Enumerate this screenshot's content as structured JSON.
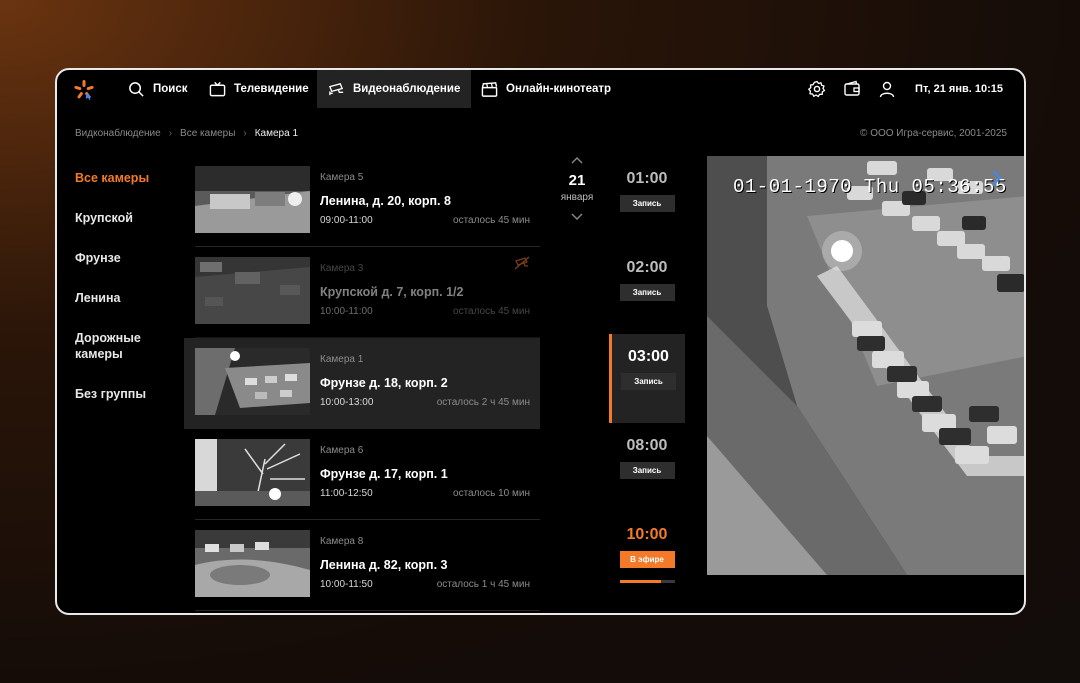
{
  "nav": {
    "items": [
      {
        "label": "Поиск",
        "icon": "search-icon"
      },
      {
        "label": "Телевидение",
        "icon": "tv-icon"
      },
      {
        "label": "Видеонаблюдение",
        "icon": "cctv-icon",
        "active": true
      },
      {
        "label": "Онлайн-кинотеатр",
        "icon": "clapperboard-icon"
      }
    ],
    "right_icons": [
      "settings-icon",
      "wallet-icon",
      "user-icon"
    ],
    "datetime": "Пт, 21 янв. 10:15"
  },
  "breadcrumbs": [
    "Видконаблюдение",
    "Все камеры",
    "Камера 1"
  ],
  "copyright": "© ООО Игра-сервис, 2001-2025",
  "groups": [
    {
      "label": "Все камеры",
      "active": true
    },
    {
      "label": "Крупской"
    },
    {
      "label": "Фрунзе"
    },
    {
      "label": "Ленина"
    },
    {
      "label": "Дорожные камеры"
    },
    {
      "label": "Без группы"
    }
  ],
  "cameras": [
    {
      "name": "Камера 5",
      "address": "Ленина, д. 20, корп. 8",
      "time": "09:00-11:00",
      "remaining": "осталось 45 мин"
    },
    {
      "name": "Камера 3",
      "address": "Крупской д. 7, корп. 1/2",
      "time": "10:00-11:00",
      "remaining": "осталось 45 мин",
      "offline": true
    },
    {
      "name": "Камера 1",
      "address": "Фрунзе д. 18, корп. 2",
      "time": "10:00-13:00",
      "remaining": "осталось  2 ч 45 мин",
      "active": true
    },
    {
      "name": "Камера 6",
      "address": "Фрунзе д. 17, корп. 1",
      "time": "11:00-12:50",
      "remaining": "осталось 10 мин"
    },
    {
      "name": "Камера 8",
      "address": "Ленина д. 82, корп. 3",
      "time": "10:00-11:50",
      "remaining": "осталось 1 ч 45 мин"
    }
  ],
  "date": {
    "day": "21",
    "month": "января"
  },
  "schedule": [
    {
      "time": "01:00",
      "button": "Запись"
    },
    {
      "time": "02:00",
      "button": "Запись"
    },
    {
      "time": "03:00",
      "button": "Запись",
      "active": true
    },
    {
      "time": "08:00",
      "button": "Запись"
    },
    {
      "time": "10:00",
      "button": "В эфире",
      "live": true,
      "progress": 0.75
    }
  ],
  "video": {
    "osd": "01-01-1970 Thu 05:36:55"
  },
  "colors": {
    "accent": "#f47a2a",
    "panel": "#232323",
    "background": "#000000"
  }
}
